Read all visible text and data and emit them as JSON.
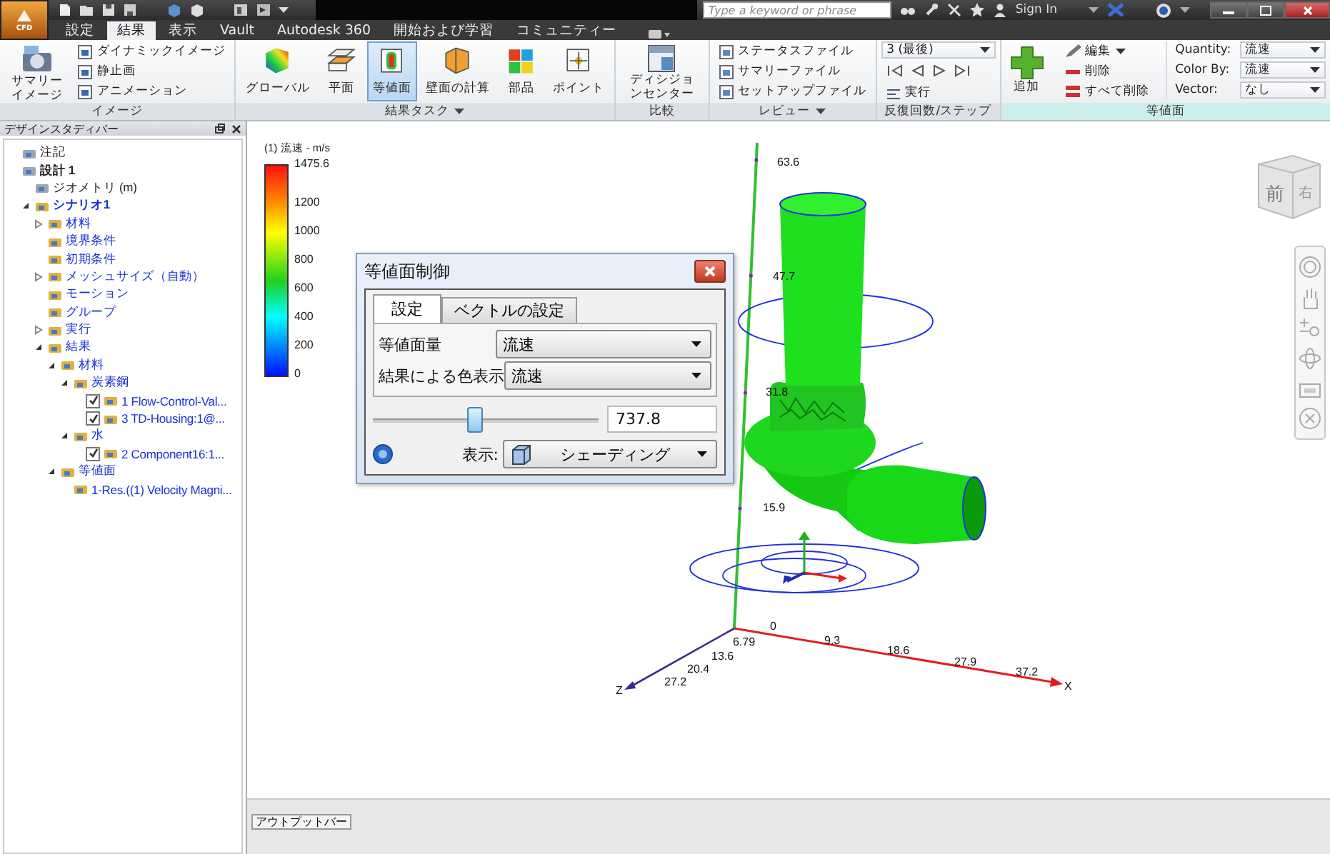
{
  "title_bar": {
    "app_button": "CFD",
    "search": {
      "placeholder": "Type a keyword or phrase"
    },
    "sign_in": "Sign In"
  },
  "ribbon": {
    "tabs": [
      {
        "label": "設定",
        "selected": false
      },
      {
        "label": "結果",
        "selected": true
      },
      {
        "label": "表示",
        "selected": false
      },
      {
        "label": "Vault",
        "selected": false
      },
      {
        "label": "Autodesk 360",
        "selected": false
      },
      {
        "label": "開始および学習",
        "selected": false
      },
      {
        "label": "コミュニティー",
        "selected": false
      }
    ],
    "image_panel": {
      "title": "イメージ",
      "large_button": "サマリーイメージ",
      "buttons": [
        "ダイナミックイメージ",
        "静止画",
        "アニメーション"
      ]
    },
    "result_tasks_panel": {
      "title": "結果タスク",
      "tools": [
        {
          "label": "グローバル",
          "selected": false
        },
        {
          "label": "平面",
          "selected": false
        },
        {
          "label": "等値面",
          "selected": true
        },
        {
          "label": "壁面の計算",
          "selected": false
        },
        {
          "label": "部品",
          "selected": false
        },
        {
          "label": "ポイント",
          "selected": false
        }
      ]
    },
    "compare_panel": {
      "title": "比較",
      "large_button": "ディシジョンセンター"
    },
    "review_panel": {
      "title": "レビュー",
      "buttons": [
        "ステータスファイル",
        "サマリーファイル",
        "セットアップファイル"
      ]
    },
    "iteration_panel": {
      "title": "反復回数/ステップ",
      "step": "3 (最後)",
      "run_button": "実行"
    },
    "isosurface_panel": {
      "title": "等値面",
      "add_button": "追加",
      "actions": [
        "編集",
        "削除",
        "すべて削除"
      ],
      "fields": [
        {
          "label": "Quantity:",
          "value": "流速"
        },
        {
          "label": "Color By:",
          "value": "流速"
        },
        {
          "label": "Vector:",
          "value": "なし"
        }
      ]
    }
  },
  "design_study_bar": {
    "title": "デザインスタディバー",
    "tree": [
      {
        "label": "注記",
        "bold": false,
        "current": false
      },
      {
        "label": "設計 1",
        "bold": true,
        "current": false,
        "children": [
          {
            "label": "ジオメトリ (m)",
            "bold": false,
            "current": false
          },
          {
            "label": "シナリオ1",
            "bold": true,
            "current": true,
            "expanded": true,
            "children": [
              {
                "label": "材料",
                "bold": false,
                "current": true,
                "expanded": false
              },
              {
                "label": "境界条件",
                "bold": false,
                "current": true
              },
              {
                "label": "初期条件",
                "bold": false,
                "current": true
              },
              {
                "label": "メッシュサイズ（自動）",
                "bold": false,
                "current": true,
                "expanded": false
              },
              {
                "label": "モーション",
                "bold": false,
                "current": true
              },
              {
                "label": "グループ",
                "bold": false,
                "current": true
              },
              {
                "label": "実行",
                "bold": false,
                "current": true,
                "expanded": false
              },
              {
                "label": "結果",
                "bold": false,
                "current": true,
                "expanded": true,
                "children": [
                  {
                    "label": "材料",
                    "bold": false,
                    "current": true,
                    "expanded": true,
                    "children": [
                      {
                        "label": "炭素鋼",
                        "bold": false,
                        "current": true,
                        "expanded": true,
                        "children": [
                          {
                            "label": "1 Flow-Control-Val...",
                            "bold": false,
                            "current": true,
                            "checked": true
                          },
                          {
                            "label": "3 TD-Housing:1@...",
                            "bold": false,
                            "current": true,
                            "checked": true
                          }
                        ]
                      },
                      {
                        "label": "水",
                        "bold": false,
                        "current": true,
                        "expanded": true,
                        "children": [
                          {
                            "label": "2 Component16:1...",
                            "bold": false,
                            "current": true,
                            "checked": true
                          }
                        ]
                      }
                    ]
                  },
                  {
                    "label": "等値面",
                    "bold": false,
                    "current": true,
                    "expanded": true,
                    "children": [
                      {
                        "label": "1-Res.((1) Velocity Magni...",
                        "bold": false,
                        "current": true
                      }
                    ]
                  }
                ]
              }
            ]
          }
        ]
      }
    ]
  },
  "viewport": {
    "legend": {
      "title": "(1) 流速 - m/s",
      "ticks": [
        "1475.6",
        "1200",
        "1000",
        "800",
        "600",
        "400",
        "200",
        "0"
      ]
    },
    "axes": {
      "y_ticks": [
        "63.6",
        "47.7",
        "31.8",
        "15.9"
      ],
      "x_ticks": [
        "0",
        "9.3",
        "18.6",
        "27.9",
        "37.2"
      ],
      "x_label": "X",
      "z_ticks": [
        "6.79",
        "13.6",
        "20.4",
        "27.2"
      ],
      "z_label": "Z"
    },
    "view_cube": {
      "faces": [
        "前",
        "右"
      ]
    },
    "isosurface_dialog": {
      "title": "等値面制御",
      "tabs": [
        {
          "label": "設定",
          "selected": true
        },
        {
          "label": "ベクトルの設定",
          "selected": false
        }
      ],
      "fields": [
        {
          "label": "等値面量",
          "value": "流速"
        },
        {
          "label": "結果による色表示",
          "value": "流速"
        }
      ],
      "slider": {
        "level": 0.44
      },
      "value": "737.8",
      "display": {
        "label": "表示:",
        "value": "シェーディング"
      }
    }
  },
  "output_bar": {
    "tab": "アウトプットバー"
  }
}
